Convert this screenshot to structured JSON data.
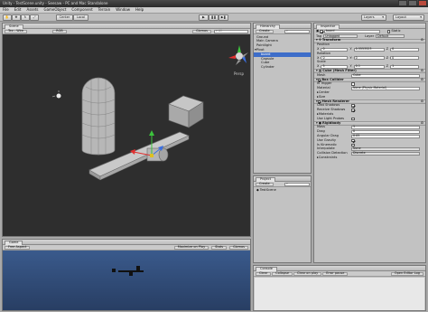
{
  "window": {
    "title": "Unity - TestScene.unity - Seesaw - PC and Mac Standalone"
  },
  "menu": [
    "File",
    "Edit",
    "Assets",
    "GameObject",
    "Component",
    "Terrain",
    "Window",
    "Help"
  ],
  "toolbar": {
    "center": "Center",
    "local": "Local",
    "layers": "Layers",
    "layout": "Layout"
  },
  "scene": {
    "tab": "Scene",
    "shading": "Tex - Wire",
    "render": "RGB",
    "gizmos": "Gizmos",
    "search_placeholder": "All",
    "view_label": "Persp"
  },
  "game": {
    "tab": "Game",
    "aspect": "Free Aspect",
    "maximize": "Maximize on Play",
    "stats": "Stats",
    "gizmos": "Gizmos"
  },
  "hierarchy": {
    "tab": "Hierarchy",
    "create": "Create",
    "items": [
      {
        "label": "Ground",
        "indent": 0,
        "selected": false
      },
      {
        "label": "Main Camera",
        "indent": 0,
        "selected": false
      },
      {
        "label": "Pointlight",
        "indent": 0,
        "selected": false
      },
      {
        "label": "Pivot",
        "indent": 0,
        "selected": false
      },
      {
        "label": "board",
        "indent": 1,
        "selected": true
      },
      {
        "label": "Capsule",
        "indent": 1,
        "selected": false
      },
      {
        "label": "Cube",
        "indent": 1,
        "selected": false
      },
      {
        "label": "Cylinder",
        "indent": 1,
        "selected": false
      }
    ]
  },
  "project": {
    "tab": "Project",
    "create": "Create",
    "items": [
      {
        "label": "TestScene"
      }
    ]
  },
  "inspector": {
    "tab": "Inspector",
    "object_name": "board",
    "static": "Static",
    "tag_label": "Tag",
    "tag_value": "Untagged",
    "layer_label": "Layer",
    "layer_value": "Default",
    "transform": {
      "title": "Transform",
      "position": {
        "label": "Position",
        "x": "0",
        "y": "0.5553523",
        "z": "0"
      },
      "rotation": {
        "label": "Rotation",
        "x": "0",
        "y": "0",
        "z": "0"
      },
      "scale": {
        "label": "Scale",
        "x": "5",
        "y": "0.1",
        "z": "1"
      }
    },
    "mesh_filter": {
      "title": "Cube (Mesh Filter)",
      "mesh_label": "Mesh",
      "mesh_value": "Cube"
    },
    "box_collider": {
      "title": "Box Collider",
      "is_trigger": "Is Trigger",
      "material_label": "Material",
      "material_value": "None (Physic Material)",
      "center": "Center",
      "size": "Size"
    },
    "mesh_renderer": {
      "title": "Mesh Renderer",
      "cast_shadows": "Cast Shadows",
      "receive_shadows": "Receive Shadows",
      "materials": "Materials",
      "use_light_probes": "Use Light Probes"
    },
    "rigidbody": {
      "title": "Rigidbody",
      "mass": {
        "label": "Mass",
        "value": "1"
      },
      "drag": {
        "label": "Drag",
        "value": "0"
      },
      "angular_drag": {
        "label": "Angular Drag",
        "value": "0.05"
      },
      "use_gravity": "Use Gravity",
      "is_kinematic": "Is Kinematic",
      "interpolate": {
        "label": "Interpolate",
        "value": "None"
      },
      "collision_detection": {
        "label": "Collision Detection",
        "value": "Discrete"
      },
      "constraints": "Constraints"
    }
  },
  "console": {
    "tab": "Console",
    "clear": "Clear",
    "collapse": "Collapse",
    "clear_on_play": "Clear on play",
    "error_pause": "Error pause",
    "open_editor_log": "Open Editor Log"
  }
}
